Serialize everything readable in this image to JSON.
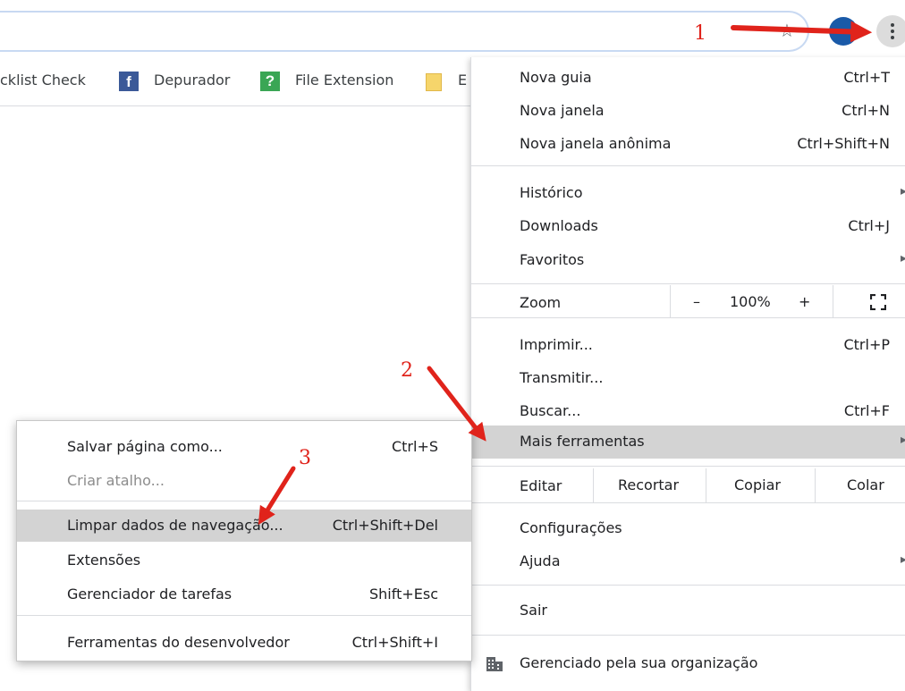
{
  "toolbar": {
    "omnibox_value": "",
    "star_icon": "star-outline-icon",
    "profile_icon": "avatar",
    "menu_icon": "three-dots-vertical-icon"
  },
  "bookmarks": [
    {
      "label": "cklist Check",
      "icon": ""
    },
    {
      "label": "Depurador",
      "icon": "facebook-icon",
      "glyph": "f"
    },
    {
      "label": "File Extension",
      "icon": "question-icon",
      "glyph": "?"
    },
    {
      "label": "E",
      "icon": "folder-icon"
    }
  ],
  "menu": {
    "nova_guia": {
      "label": "Nova guia",
      "shortcut": "Ctrl+T"
    },
    "nova_janela": {
      "label": "Nova janela",
      "shortcut": "Ctrl+N"
    },
    "nova_janela_anonima": {
      "label": "Nova janela anônima",
      "shortcut": "Ctrl+Shift+N"
    },
    "historico": {
      "label": "Histórico"
    },
    "downloads": {
      "label": "Downloads",
      "shortcut": "Ctrl+J"
    },
    "favoritos": {
      "label": "Favoritos"
    },
    "zoom": {
      "label": "Zoom",
      "minus": "–",
      "value": "100%",
      "plus": "+",
      "fullscreen_icon": "fullscreen-icon"
    },
    "imprimir": {
      "label": "Imprimir...",
      "shortcut": "Ctrl+P"
    },
    "transmitir": {
      "label": "Transmitir..."
    },
    "buscar": {
      "label": "Buscar...",
      "shortcut": "Ctrl+F"
    },
    "mais_ferramentas": {
      "label": "Mais ferramentas"
    },
    "editar": {
      "label": "Editar",
      "recortar": "Recortar",
      "copiar": "Copiar",
      "colar": "Colar"
    },
    "configuracoes": {
      "label": "Configurações"
    },
    "ajuda": {
      "label": "Ajuda"
    },
    "sair": {
      "label": "Sair"
    },
    "gerenciado": {
      "label": "Gerenciado pela sua organização",
      "icon": "building-icon"
    }
  },
  "submenu": {
    "salvar": {
      "label": "Salvar página como...",
      "shortcut": "Ctrl+S"
    },
    "criar_atalho": {
      "label": "Criar atalho..."
    },
    "limpar": {
      "label": "Limpar dados de navegação...",
      "shortcut": "Ctrl+Shift+Del"
    },
    "extensoes": {
      "label": "Extensões"
    },
    "gerenciador": {
      "label": "Gerenciador de tarefas",
      "shortcut": "Shift+Esc"
    },
    "ferramentas_dev": {
      "label": "Ferramentas do desenvolvedor",
      "shortcut": "Ctrl+Shift+I"
    }
  },
  "annotations": {
    "step1": "1",
    "step2": "2",
    "step3": "3",
    "color": "#e0231b"
  }
}
